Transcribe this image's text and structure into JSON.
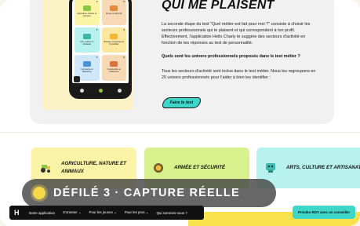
{
  "phone": {
    "tiles": [
      {
        "label": "Agriculture, Nature et Animaux",
        "color": "#fbf3a6"
      },
      {
        "label": "Armée et Sécurité",
        "color": "#f7d9b5"
      },
      {
        "label": "Arts, Culture et Artisanat",
        "color": "#b8f2ee"
      },
      {
        "label": "Banque, Assurance et Immobilier",
        "color": "#fbe7a0"
      },
      {
        "label": "Commerce et Marketing",
        "color": "#cfe7fb"
      },
      {
        "label": "Construction et Urbanisme",
        "color": "#f7d9b5"
      }
    ]
  },
  "section": {
    "title": "QUI ME PLAISENT",
    "paragraph1": "La seconde étape du test \"Quel métier est fait pour moi ?\" consiste à choisir les secteurs professionnels qui te plaisent et qui correspondent à ton profil. Effectivement, l'application Hello Charly te suggère des secteurs d'activité en fonction de tes réponses au test de personnalité.",
    "question": "Quels sont les univers professionnels proposés dans le test métier ?",
    "paragraph2": "Tous les secteurs d'activité sont inclus dans le test métier. Nous les regroupons en 20 univers professionnels pour t'aider à bien les identifier :",
    "cta": "Faire le test"
  },
  "categories": [
    {
      "label": "AGRICULTURE, NATURE ET ANIMAUX",
      "icon": "tractor-icon"
    },
    {
      "label": "ARMÉE ET SÉCURITÉ",
      "icon": "medal-icon"
    },
    {
      "label": "ARTS, CULTURE ET ARTISANAT",
      "icon": "theater-icon"
    }
  ],
  "overlay": {
    "text": "DÉFILÉ 3 · CAPTURE RÉELLE"
  },
  "nav": {
    "logo": "H",
    "items": [
      "Notre application",
      "S'orienter ⌄",
      "Pour les jeunes ⌄",
      "Pour les pros ⌄",
      "Qui sommes-nous ?"
    ],
    "cta": "Prendre RDV avec un conseiller"
  }
}
